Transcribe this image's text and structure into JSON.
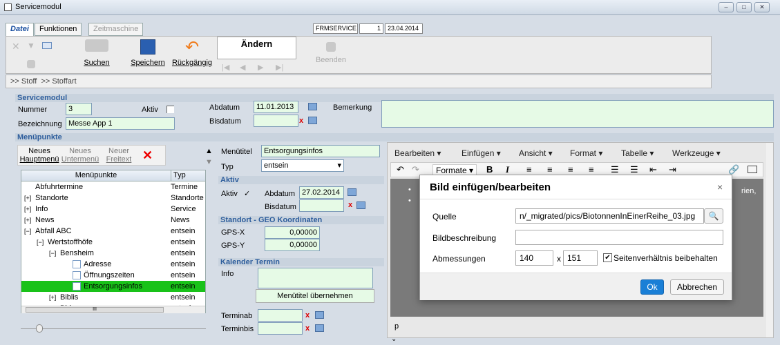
{
  "window": {
    "title": "Servicemodul",
    "min": "–",
    "max": "□",
    "close": "✕"
  },
  "tabs": [
    "Datei",
    "Funktionen",
    "Zeitmaschine"
  ],
  "header": {
    "code": "FRMSERVICE",
    "num": "1",
    "date": "23.04.2014"
  },
  "toolbar": {
    "suchen": "Suchen",
    "speichern": "Speichern",
    "rueck": "Rückgängig",
    "aendern": "Ändern",
    "beenden": "Beenden"
  },
  "navbar": {
    "item1": "Stoff",
    "item2": "Stoffart",
    "sep": ">>"
  },
  "servicemodul": {
    "title": "Servicemodul",
    "nummer_label": "Nummer",
    "nummer": "3",
    "aktiv_label": "Aktiv",
    "bezeichnung_label": "Bezeichnung",
    "bezeichnung": "Messe App 1",
    "abdatum_label": "Abdatum",
    "abdatum": "11.01.2013",
    "bisdatum_label": "Bisdatum",
    "bisdatum": "",
    "bemerkung_label": "Bemerkung",
    "bemerkung": ""
  },
  "menue": {
    "title": "Menüpunkte",
    "neues_haupt_1": "Neues",
    "neues_haupt_2": "Hauptmenü",
    "neues_unter_1": "Neues",
    "neues_unter_2": "Untermenü",
    "neuer_frei_1": "Neuer",
    "neuer_frei_2": "Freitext",
    "col1": "Menüpunkte",
    "col2": "Typ",
    "rows": [
      {
        "label": "Abfuhrtermine",
        "typ": "Termine"
      },
      {
        "label": "Standorte",
        "typ": "Standorte"
      },
      {
        "label": "Info",
        "typ": "Service"
      },
      {
        "label": "News",
        "typ": "News"
      },
      {
        "label": "Abfall ABC",
        "typ": "entsein"
      },
      {
        "label": "Wertstoffhöfe",
        "typ": "entsein"
      },
      {
        "label": "Bensheim",
        "typ": "entsein"
      },
      {
        "label": "Adresse",
        "typ": "entsein"
      },
      {
        "label": "Öffnungszeiten",
        "typ": "entsein"
      },
      {
        "label": "Entsorgungsinfos",
        "typ": "entsein"
      },
      {
        "label": "Biblis",
        "typ": "entsein"
      },
      {
        "label": "Birkenau",
        "typ": "entsein"
      }
    ],
    "hscroll": "III"
  },
  "details": {
    "menuetitel_label": "Menütitel",
    "menuetitel": "Entsorgungsinfos",
    "typ_label": "Typ",
    "typ": "entsein",
    "aktiv_hdr": "Aktiv",
    "aktiv_label": "Aktiv",
    "aktiv_check": "✓",
    "abdatum_label": "Abdatum",
    "abdatum": "27.02.2014",
    "bisdatum_label": "Bisdatum",
    "geo_hdr": "Standort - GEO Koordinaten",
    "gpsx_label": "GPS-X",
    "gpsx": "0,00000",
    "gpsy_label": "GPS-Y",
    "gpsy": "0,00000",
    "kal_hdr": "Kalender Termin",
    "info_label": "Info",
    "uebernehmen": "Menütitel übernehmen",
    "terminab_label": "Terminab",
    "terminbis_label": "Terminbis"
  },
  "editor": {
    "menus": [
      "Bearbeiten ▾",
      "Einfügen ▾",
      "Ansicht ▾",
      "Format ▾",
      "Tabelle ▾",
      "Werkzeuge ▾"
    ],
    "formate": "Formate ▾",
    "bold": "B",
    "italic": "I",
    "status": "p",
    "trailing": "rien,"
  },
  "modal": {
    "title": "Bild einfügen/bearbeiten",
    "close": "×",
    "quelle_label": "Quelle",
    "quelle": "n/_migrated/pics/BiotonnenInEinerReihe_03.jpg",
    "beschr_label": "Bildbeschreibung",
    "beschr": "",
    "abm_label": "Abmessungen",
    "width": "140",
    "x": "x",
    "height": "151",
    "ratio_label": "Seitenverhältnis beibehalten",
    "ok": "Ok",
    "cancel": "Abbrechen"
  },
  "colors": {
    "accent": "#2d5d9c",
    "field": "#e6fae6",
    "selected": "#19c219",
    "ok": "#1a7fd6"
  }
}
